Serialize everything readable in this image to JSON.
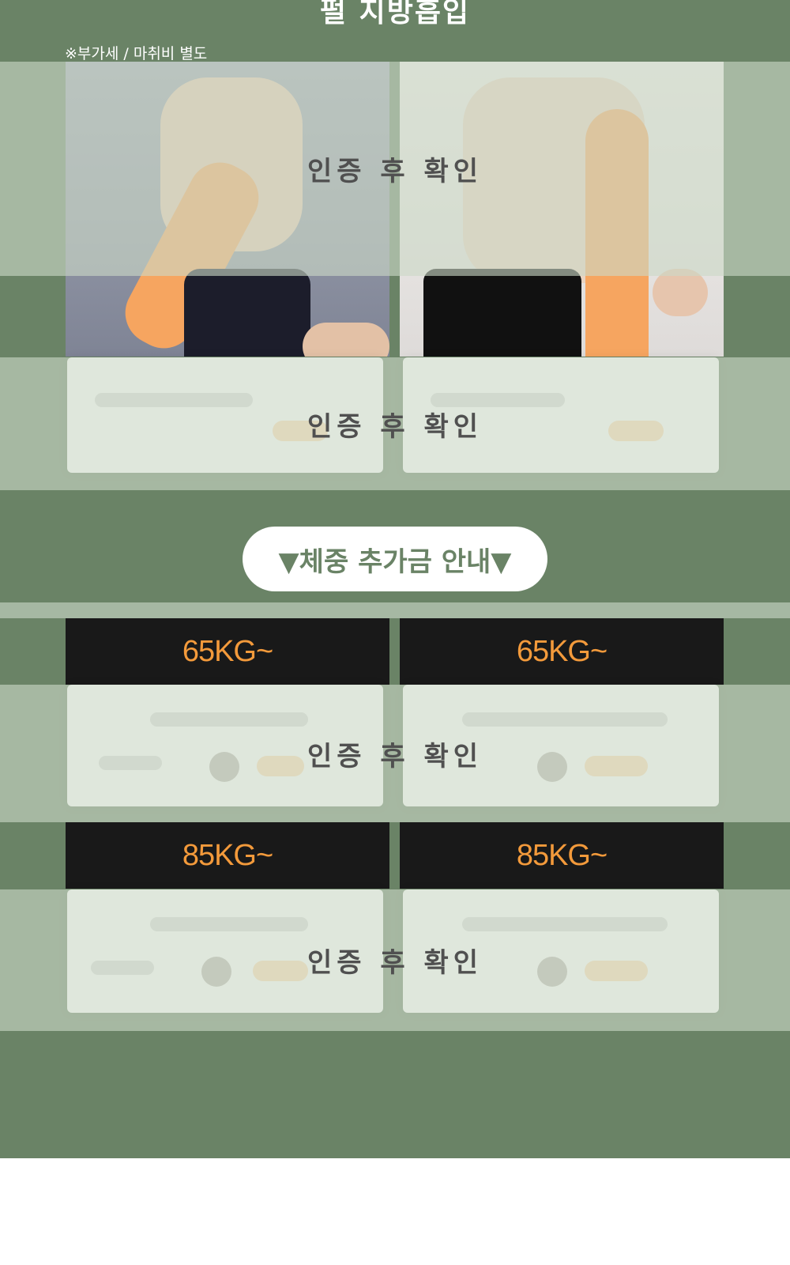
{
  "header": {
    "title": "펄 지방흡입",
    "vat_note": "※부가세 / 마취비 별도"
  },
  "overlays": {
    "photo": "인증 후 확인",
    "price_1": "인증 후 확인",
    "weight_65": "인증 후 확인",
    "weight_85": "인증 후 확인"
  },
  "weight_section": {
    "title": "▼체중 추가금 안내▼",
    "tiers": [
      {
        "left": "65KG~",
        "right": "65KG~"
      },
      {
        "left": "85KG~",
        "right": "85KG~"
      }
    ]
  },
  "colors": {
    "background_green": "#6a8366",
    "overlay": "#cbd8c7",
    "kg_text": "#f39a3b",
    "kg_bar": "#191919",
    "highlight_orange": "#f6a560"
  }
}
